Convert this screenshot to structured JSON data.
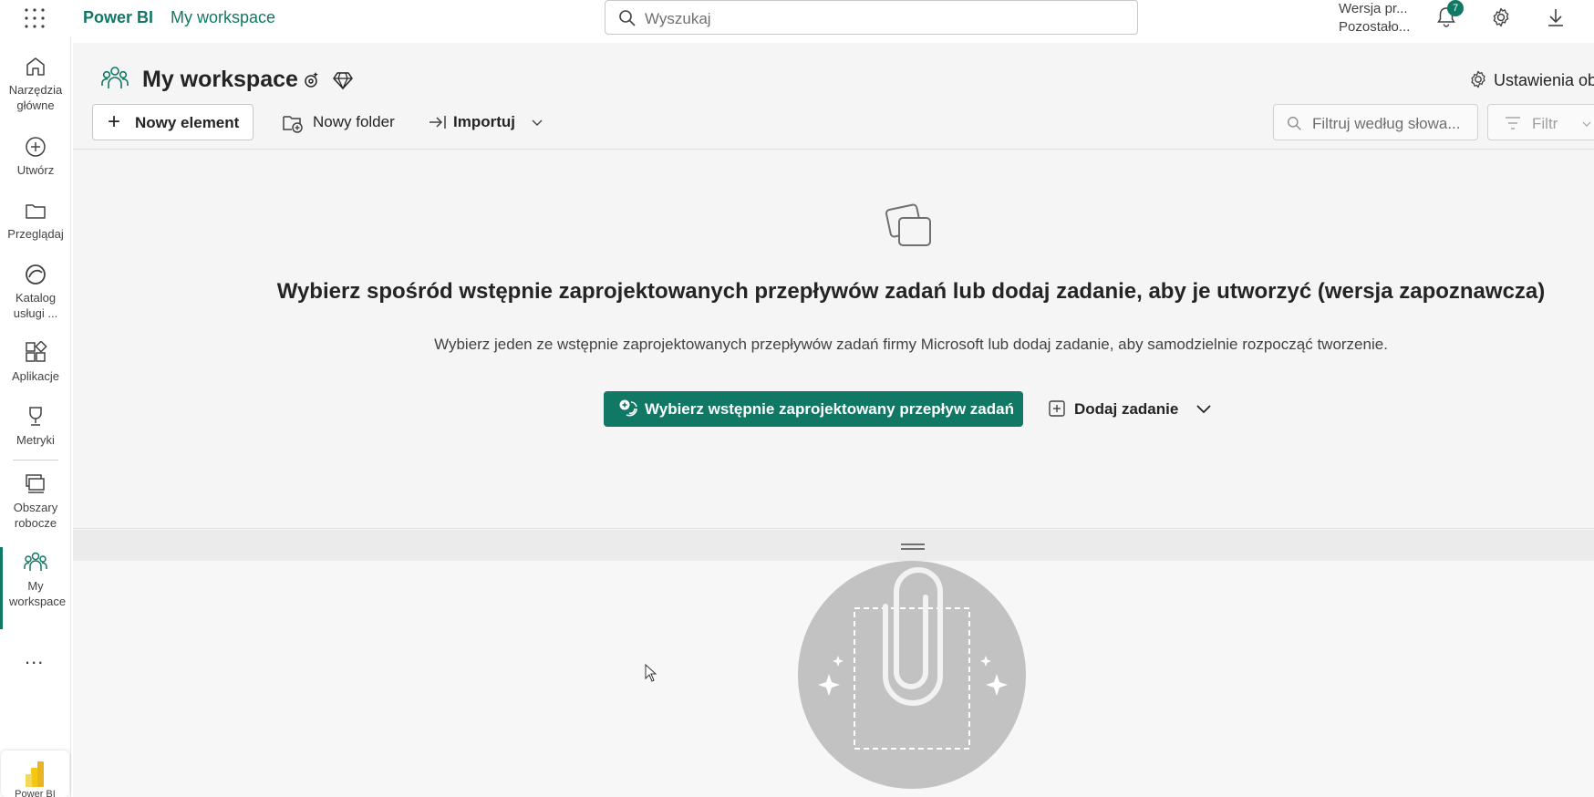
{
  "topbar": {
    "brand": "Power BI",
    "breadcrumb": "My workspace",
    "search_placeholder": "Wyszukaj",
    "trial_line1": "Wersja pr...",
    "trial_line2": "Pozostało...",
    "notification_count": "7"
  },
  "rail": {
    "items": [
      {
        "label": "Narzędzia główne",
        "icon": "home-icon"
      },
      {
        "label": "Utwórz",
        "icon": "create-icon"
      },
      {
        "label": "Przeglądaj",
        "icon": "browse-icon"
      },
      {
        "label": "Katalog usługi ...",
        "icon": "catalog-icon"
      },
      {
        "label": "Aplikacje",
        "icon": "apps-icon"
      },
      {
        "label": "Metryki",
        "icon": "metrics-icon"
      },
      {
        "label": "Obszary robocze",
        "icon": "workspaces-icon"
      },
      {
        "label": "My workspace",
        "icon": "my-workspace-icon"
      }
    ],
    "more": "...",
    "footer_label": "Power BI"
  },
  "workspace": {
    "title": "My workspace",
    "settings_label": "Ustawienia ob"
  },
  "toolbar": {
    "new_item": "Nowy element",
    "new_folder": "Nowy folder",
    "import": "Importuj",
    "filter_placeholder": "Filtruj według słowa...",
    "filter": "Filtr"
  },
  "taskflow": {
    "title": "Wybierz spośród wstępnie zaprojektowanych przepływów zadań lub dodaj zadanie, aby je utworzyć (wersja zapoznawcza)",
    "subtitle": "Wybierz jeden ze wstępnie zaprojektowanych przepływów zadań firmy Microsoft lub dodaj zadanie, aby samodzielnie rozpocząć tworzenie.",
    "primary_button": "Wybierz wstępnie zaprojektowany przepływ zadań",
    "add_task": "Dodaj zadanie"
  },
  "colors": {
    "accent": "#117865",
    "background": "#f5f5f5"
  }
}
